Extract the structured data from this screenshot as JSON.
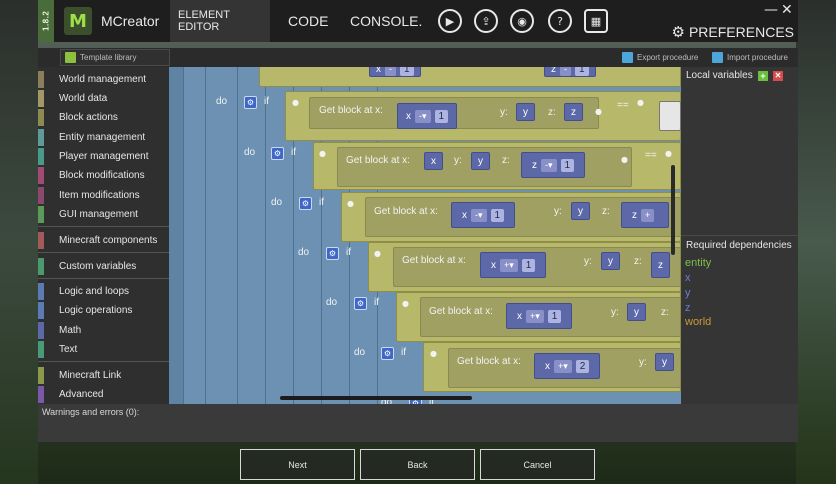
{
  "app": {
    "version": "1.8.2",
    "name": "MCreator",
    "logo_letter": "M"
  },
  "tabs": {
    "element_editor": "ELEMENT EDITOR",
    "code": "CODE",
    "console": "CONSOLE."
  },
  "toolbar_icons": [
    "run-icon",
    "export-icon",
    "setup-icon",
    "help-icon",
    "build-icon"
  ],
  "preferences": "PREFERENCES",
  "window": {
    "minimize": "—",
    "close": "✕"
  },
  "subbar": {
    "template_library": "Template library",
    "export_procedure": "Export procedure",
    "import_procedure": "Import procedure"
  },
  "palette": [
    {
      "label": "World management",
      "color": "#8b7e5a"
    },
    {
      "label": "World data",
      "color": "#a69866"
    },
    {
      "label": "Block actions",
      "color": "#8f8a52"
    },
    {
      "label": "Entity management",
      "color": "#5f9a9a"
    },
    {
      "label": "Player management",
      "color": "#4a9a8a"
    },
    {
      "label": "Block modifications",
      "color": "#a04a75"
    },
    {
      "label": "Item modifications",
      "color": "#8a4a6f"
    },
    {
      "label": "GUI management",
      "color": "#5c9a5c"
    },
    {
      "label": "Minecraft components",
      "color": "#a45a5a"
    },
    {
      "label": "Custom variables",
      "color": "#4a9a6f"
    },
    {
      "label": "Logic and loops",
      "color": "#5a7bb3"
    },
    {
      "label": "Logic operations",
      "color": "#5a7bb3"
    },
    {
      "label": "Math",
      "color": "#5c68a8"
    },
    {
      "label": "Text",
      "color": "#4a9a7a"
    },
    {
      "label": "Minecraft Link",
      "color": "#8a9a4a"
    },
    {
      "label": "Advanced",
      "color": "#7a5aa8"
    }
  ],
  "blocks": {
    "do_label": "do",
    "if_label": "if",
    "get_block": "Get block at x:",
    "x": "x",
    "y": "y:",
    "z": "z:",
    "var_x": "x",
    "var_y": "y",
    "var_z": "z",
    "eq": "==",
    "rows": [
      {
        "op_axis": "x",
        "op": "-",
        "val": "1"
      },
      {
        "op_axis": "z",
        "op": "-",
        "val": "1"
      },
      {
        "op_axis": "x",
        "op": "-",
        "val": "1",
        "extra": "+"
      },
      {
        "op_axis": "x",
        "op": "+",
        "val": "1"
      },
      {
        "op_axis": "x",
        "op": "+",
        "val": "1"
      },
      {
        "op_axis": "x",
        "op": "+",
        "val": "2"
      }
    ]
  },
  "right_panel": {
    "local_variables": "Local variables",
    "required_dependencies": "Required dependencies",
    "dependencies": [
      {
        "name": "entity",
        "color": "#7fc04a"
      },
      {
        "name": "x",
        "color": "#6a7fd6"
      },
      {
        "name": "y",
        "color": "#6a7fd6"
      },
      {
        "name": "z",
        "color": "#6a7fd6"
      },
      {
        "name": "world",
        "color": "#c99a3a"
      }
    ]
  },
  "warnings": "Warnings and errors (0):",
  "buttons": {
    "next": "Next",
    "back": "Back",
    "cancel": "Cancel"
  }
}
